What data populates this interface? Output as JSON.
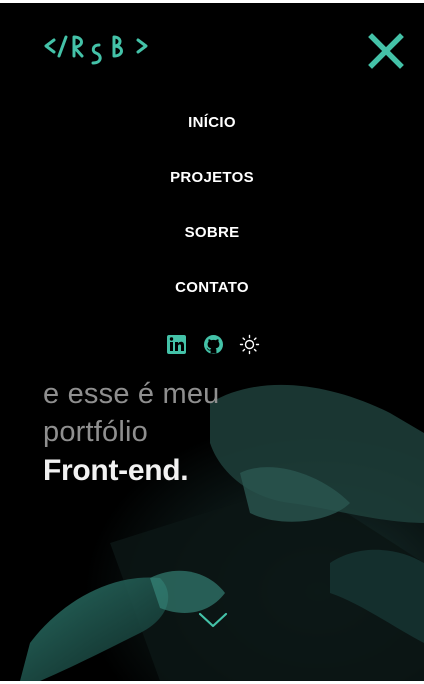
{
  "brand": {
    "logo_text": "</RSB>",
    "accent_color": "#44c2a8"
  },
  "menu": {
    "close_icon": "close-icon",
    "items": [
      {
        "label": "INÍCIO"
      },
      {
        "label": "PROJETOS"
      },
      {
        "label": "SOBRE"
      },
      {
        "label": "CONTATO"
      }
    ],
    "social": [
      {
        "icon": "linkedin-icon"
      },
      {
        "icon": "github-icon"
      },
      {
        "icon": "sun-icon"
      }
    ]
  },
  "hero": {
    "line1": "e esse é meu",
    "line2": "portfólio",
    "line3": "Front-end."
  },
  "scroll_icon": "chevron-down-icon"
}
